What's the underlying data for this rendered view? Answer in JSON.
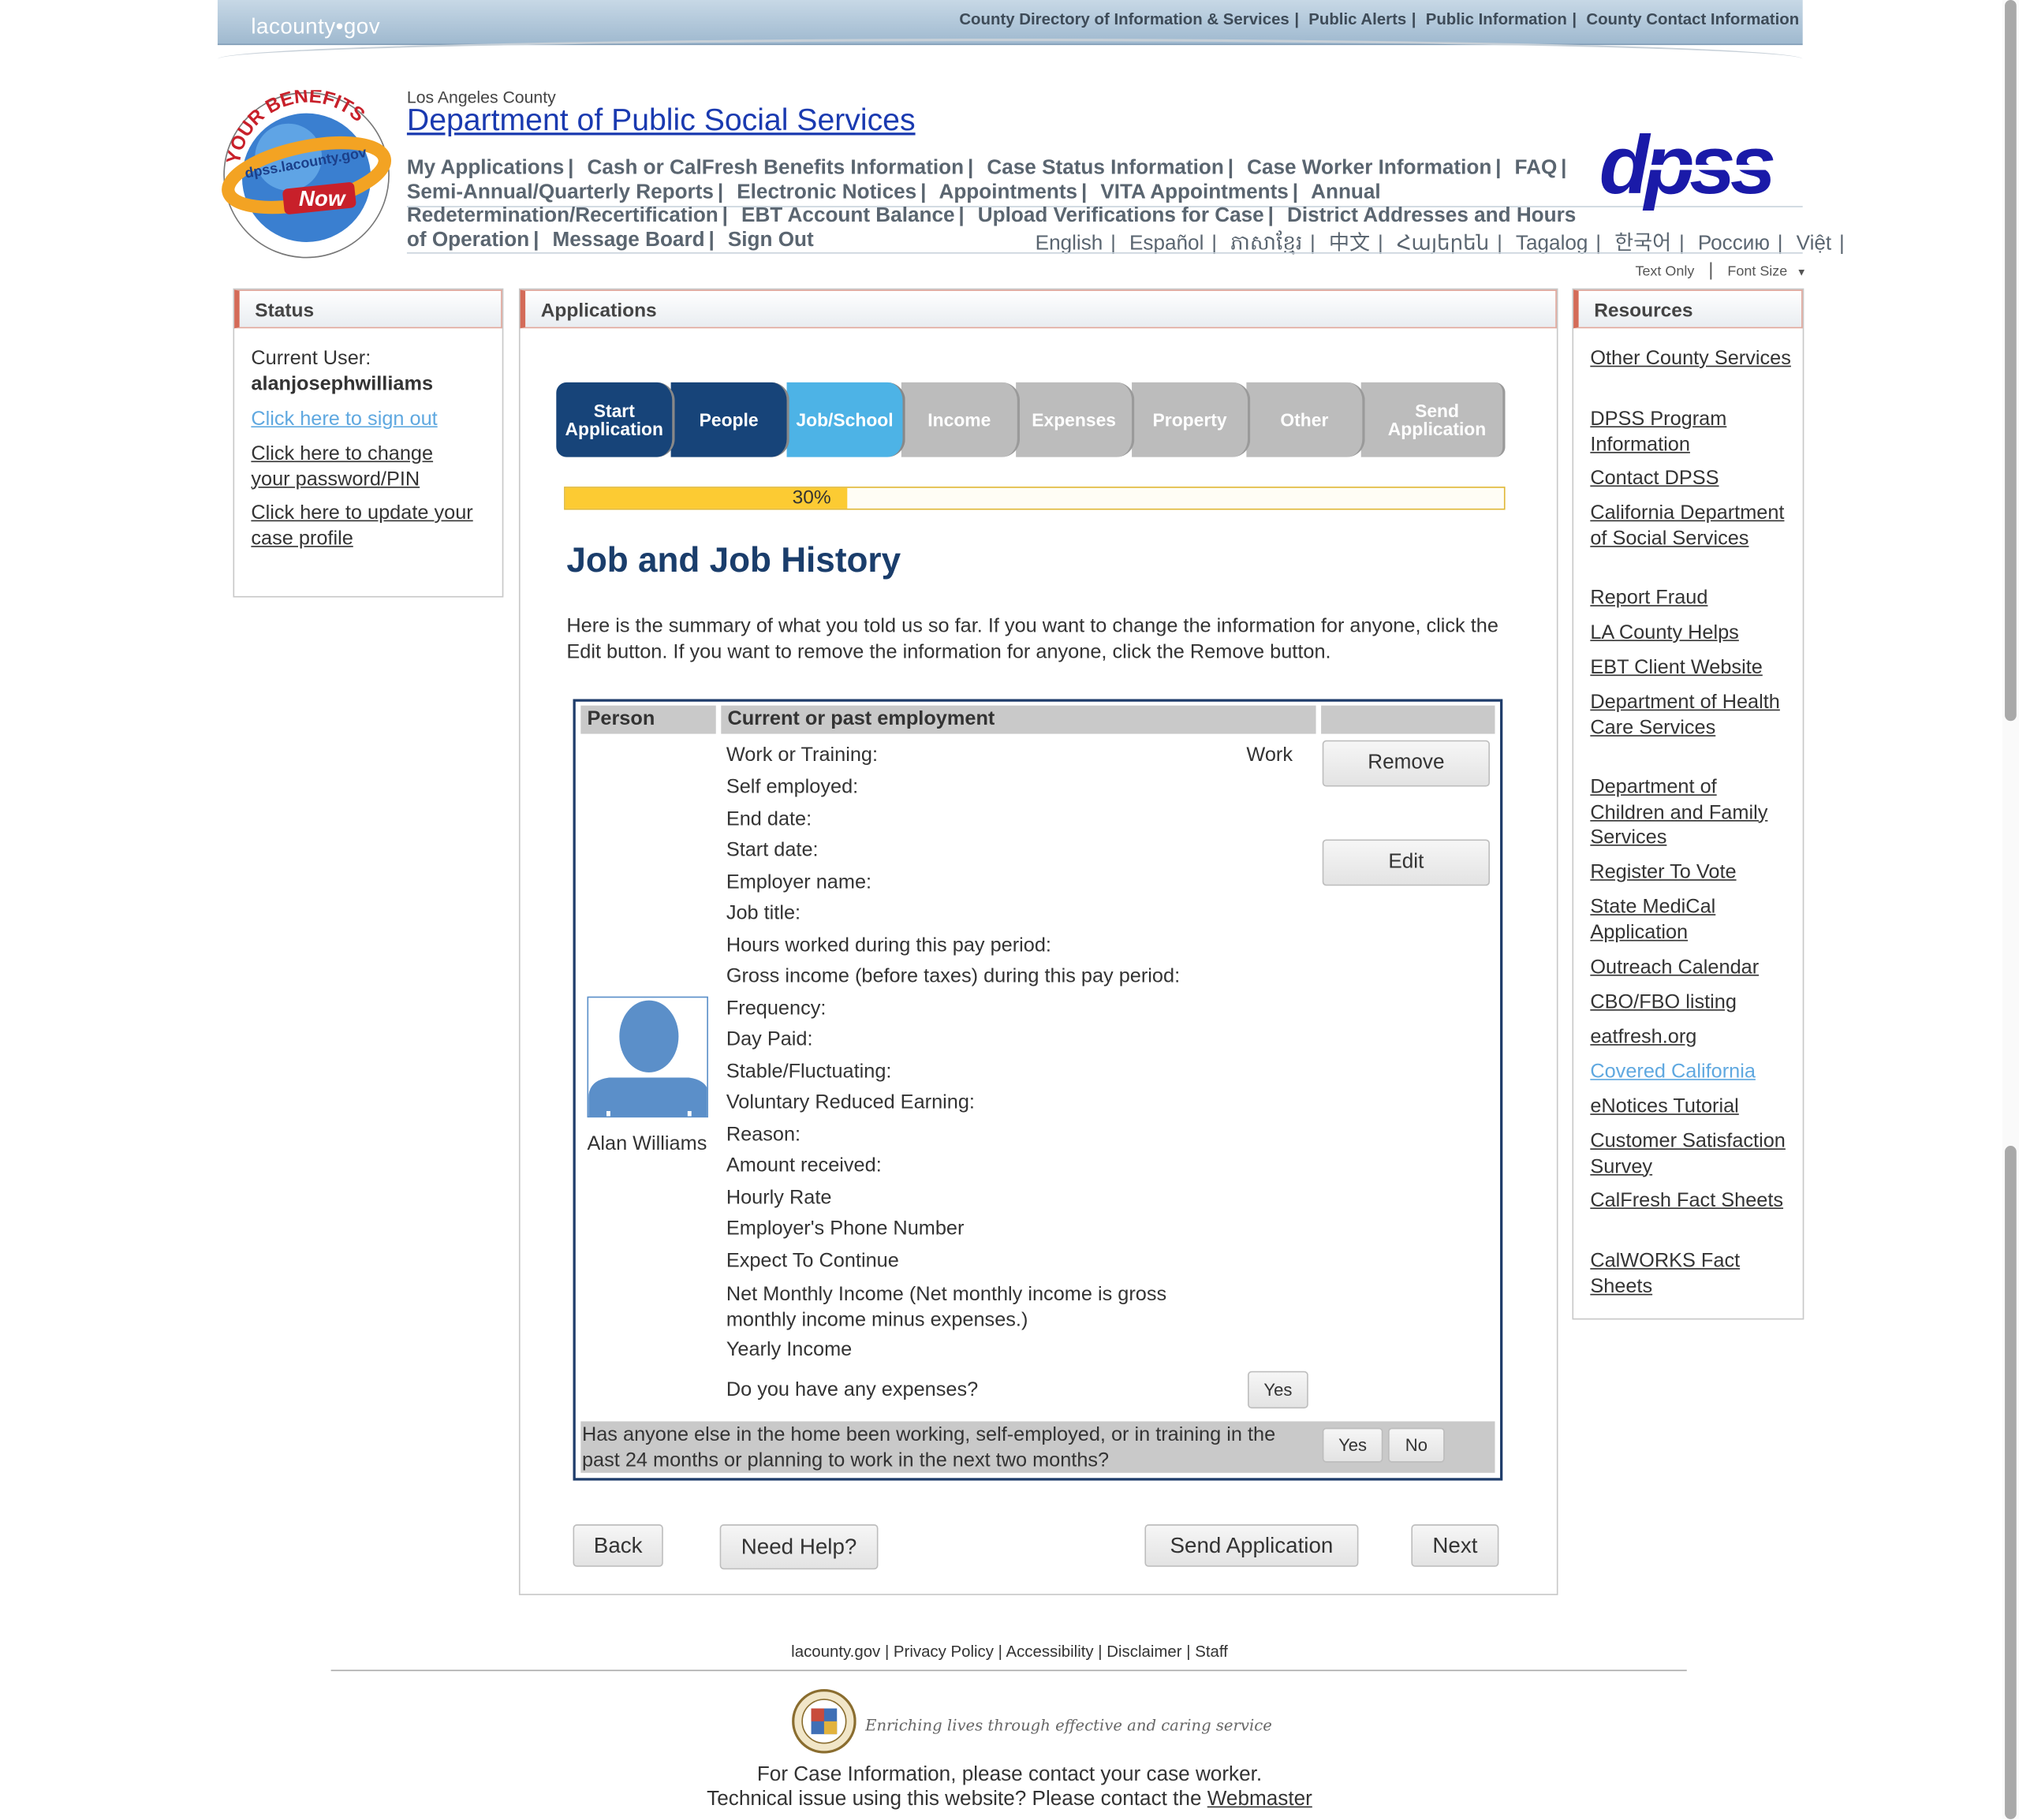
{
  "topbar": {
    "site_logo": "lacounty•gov",
    "links": [
      "County Directory of Information & Services",
      "Public Alerts",
      "Public Information",
      "County Contact Information"
    ]
  },
  "header": {
    "county": "Los Angeles County",
    "dept_title": "Department of Public Social Services",
    "seal_text_top": "YOUR BENEFITS",
    "seal_text_mid": "dpss.lacounty.gov",
    "seal_text_now": "Now",
    "dpss_logo": "dpss",
    "nav": [
      "My Applications",
      "Cash or CalFresh Benefits Information",
      "Case Status Information",
      "Case Worker Information",
      "FAQ",
      "Semi-Annual/Quarterly Reports",
      "Electronic Notices",
      "Appointments",
      "VITA Appointments",
      "Annual Redetermination/Recertification",
      "EBT Account Balance",
      "Upload Verifications for Case",
      "District Addresses and Hours of Operation",
      "Message Board",
      "Sign Out"
    ],
    "languages": [
      "English",
      "Español",
      "ភាសាខ្មែរ",
      "中文",
      "Հայերեն",
      "Tagalog",
      "한국어",
      "Россию",
      "Việt"
    ],
    "text_only": "Text Only",
    "font_size": "Font Size"
  },
  "status": {
    "title": "Status",
    "current_user_label": "Current User:",
    "username": "alanjosephwilliams",
    "sign_out": "Click here to sign out",
    "change_password": "Click here to change your password/PIN",
    "update_profile": "Click here to update your case profile"
  },
  "applications": {
    "title": "Applications",
    "steps": [
      {
        "label": "Start Application",
        "state": "done"
      },
      {
        "label": "People",
        "state": "done"
      },
      {
        "label": "Job/School",
        "state": "active"
      },
      {
        "label": "Income",
        "state": "todo"
      },
      {
        "label": "Expenses",
        "state": "todo"
      },
      {
        "label": "Property",
        "state": "todo"
      },
      {
        "label": "Other",
        "state": "todo"
      },
      {
        "label": "Send Application",
        "state": "todo"
      }
    ],
    "progress_label": "30%",
    "progress_fraction": 0.3,
    "heading": "Job and Job History",
    "intro": "Here is the summary of what you told us so far. If you want to change the information for anyone, click the Edit button. If you want to remove the information for anyone, click the Remove button.",
    "table": {
      "col_person": "Person",
      "col_employment": "Current or past employment",
      "person_name": "Alan Williams",
      "fields": [
        "Work or Training:",
        "Self employed:",
        "End date:",
        "Start date:",
        "Employer name:",
        "Job title:",
        "Hours worked during this pay period:",
        "Gross income (before taxes) during this pay period:",
        "Frequency:",
        "Day Paid:",
        "Stable/Fluctuating:",
        "Voluntary Reduced Earning:",
        "Reason:",
        "Amount received:",
        "Hourly Rate",
        "Employer's Phone Number",
        "Expect To Continue"
      ],
      "net_monthly": "Net Monthly Income (Net monthly income is gross monthly income minus expenses.)",
      "yearly_income": "Yearly Income",
      "work_value": "Work",
      "remove_label": "Remove",
      "edit_label": "Edit",
      "expenses_question": "Do you have any expenses?",
      "expenses_answer": "Yes",
      "anyone_else_question": "Has anyone else in the home been working, self-employed, or in training in the past 24 months or planning to work in the next two months?",
      "yes_label": "Yes",
      "no_label": "No"
    },
    "buttons": {
      "back": "Back",
      "help": "Need Help?",
      "send": "Send Application",
      "next": "Next"
    }
  },
  "resources": {
    "title": "Resources",
    "links": [
      "Other County Services",
      "DPSS Program Information",
      "Contact DPSS",
      "California Department of Social Services",
      "Report Fraud",
      "LA County Helps",
      "EBT Client Website",
      "Department of Health Care Services",
      "Department of Children and Family Services",
      "Register To Vote",
      "State MediCal Application",
      "Outreach Calendar",
      "CBO/FBO listing",
      "eatfresh.org",
      "Covered California",
      "eNotices Tutorial",
      "Customer Satisfaction Survey",
      "CalFresh Fact Sheets",
      "CalWORKS Fact Sheets"
    ]
  },
  "footer": {
    "links": [
      "lacounty.gov",
      "Privacy Policy",
      "Accessibility",
      "Disclaimer",
      "Staff"
    ],
    "motto": "Enriching lives through effective and caring service",
    "case_info": "For Case Information, please contact your case worker.",
    "tech_prefix": "Technical issue using this website? Please contact the ",
    "webmaster": "Webmaster"
  },
  "colors": {
    "step_done": "#174479",
    "step_active": "#4db3e6",
    "step_todo": "#bcbcbc",
    "progress": "#fccb33",
    "heading": "#1a3d6b",
    "dept_link": "#1a3ab0"
  }
}
